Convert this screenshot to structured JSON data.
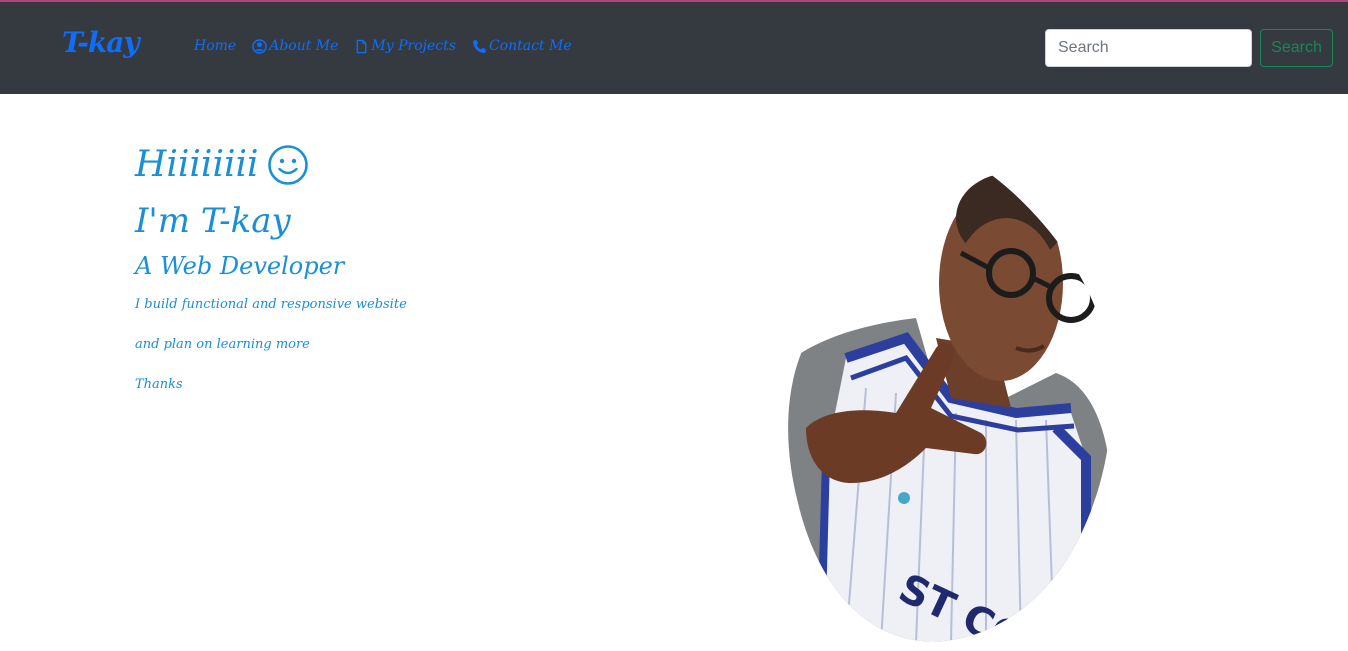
{
  "navbar": {
    "brand": "T-kay",
    "links": [
      {
        "label": "Home",
        "icon": "none"
      },
      {
        "label": "About Me",
        "icon": "user-circle-icon"
      },
      {
        "label": "My Projects",
        "icon": "file-icon"
      },
      {
        "label": "Contact Me",
        "icon": "phone-icon"
      }
    ],
    "search": {
      "placeholder": "Search",
      "button_label": "Search"
    }
  },
  "hero": {
    "greeting": "Hiiiiiiii",
    "intro": "I'm T-kay",
    "role": "A Web Developer",
    "lines": [
      "I build functional and responsive website",
      "and plan on learning more",
      "Thanks"
    ]
  },
  "colors": {
    "navbar_bg": "#343a40",
    "link": "#0d6efd",
    "hero_text": "#1a8fd6",
    "search_button": "#198754",
    "top_accent": "#b6427a"
  }
}
